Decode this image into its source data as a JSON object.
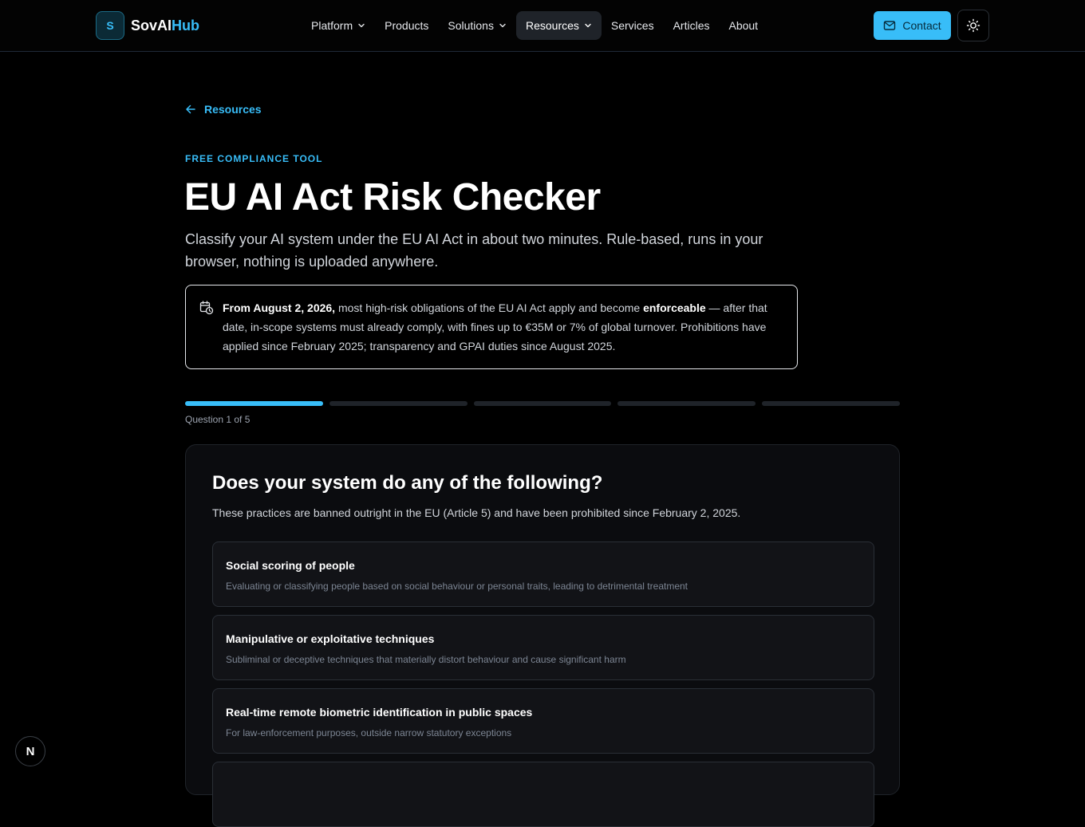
{
  "header": {
    "logo_mark": "S",
    "logo_name": "SovAI",
    "logo_accent": "Hub",
    "nav": [
      {
        "label": "Platform",
        "dropdown": true
      },
      {
        "label": "Products",
        "dropdown": false
      },
      {
        "label": "Solutions",
        "dropdown": true
      },
      {
        "label": "Resources",
        "dropdown": true,
        "active": true
      },
      {
        "label": "Services",
        "dropdown": false
      },
      {
        "label": "Articles",
        "dropdown": false
      },
      {
        "label": "About",
        "dropdown": false
      }
    ],
    "contact_label": "Contact",
    "theme_icon": "sun-icon"
  },
  "main": {
    "back_label": "Resources",
    "eyebrow": "FREE COMPLIANCE TOOL",
    "title": "EU AI Act Risk Checker",
    "lead": "Classify your AI system under the EU AI Act in about two minutes. Rule-based, runs in your browser, nothing is uploaded anywhere.",
    "notice": {
      "icon": "calendar-clock-icon",
      "date_bold": "From August 2, 2026,",
      "part1": " most high-risk obligations of the EU AI Act apply and become ",
      "bold2": "enforceable",
      "part2": " — after that date, in-scope systems must already comply, with fines up to €35M or 7% of global turnover. Prohibitions have applied since February 2025; transparency and GPAI duties since August 2025."
    },
    "progress": {
      "current": 1,
      "total": 5,
      "label": "Question 1 of 5"
    },
    "question": {
      "title": "Does your system do any of the following?",
      "subtitle": "These practices are banned outright in the EU (Article 5) and have been prohibited since February 2, 2025.",
      "options": [
        {
          "title": "Social scoring of people",
          "desc": "Evaluating or classifying people based on social behaviour or personal traits, leading to detrimental treatment"
        },
        {
          "title": "Manipulative or exploitative techniques",
          "desc": "Subliminal or deceptive techniques that materially distort behaviour and cause significant harm"
        },
        {
          "title": "Real-time remote biometric identification in public spaces",
          "desc": "For law-enforcement purposes, outside narrow statutory exceptions"
        }
      ]
    }
  },
  "fab_label": "N",
  "colors": {
    "accent": "#38bdf8",
    "background": "#000000",
    "card": "#0b0c0f"
  }
}
